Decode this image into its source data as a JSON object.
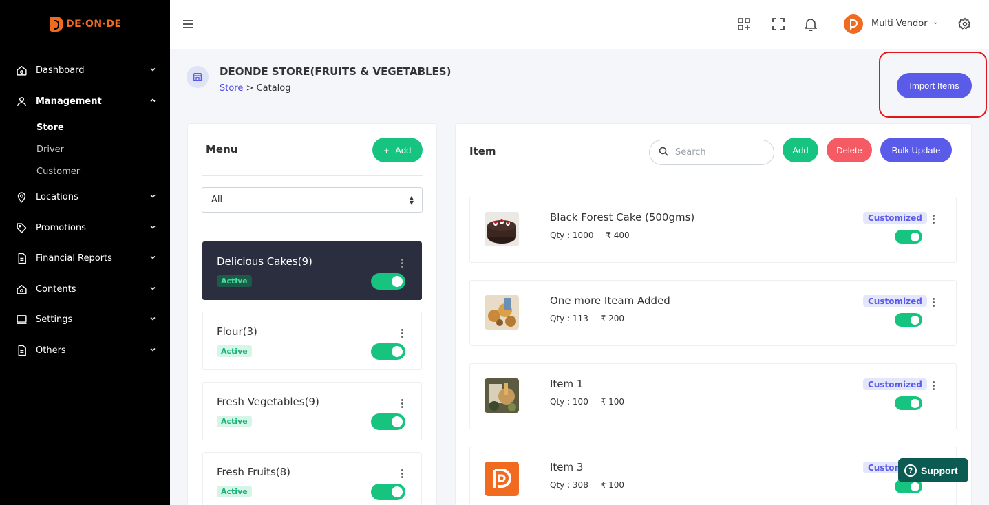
{
  "app": {
    "logo_text": "DE·ON·DE"
  },
  "sidebar": {
    "items": [
      {
        "label": "Dashboard",
        "icon": "home-icon",
        "expanded": false
      },
      {
        "label": "Management",
        "icon": "user-icon",
        "expanded": true
      },
      {
        "label": "Locations",
        "icon": "location-pin-icon",
        "expanded": false
      },
      {
        "label": "Promotions",
        "icon": "tag-icon",
        "expanded": false
      },
      {
        "label": "Financial Reports",
        "icon": "document-icon",
        "expanded": false
      },
      {
        "label": "Contents",
        "icon": "home-icon",
        "expanded": false
      },
      {
        "label": "Settings",
        "icon": "monitor-icon",
        "expanded": false
      },
      {
        "label": "Others",
        "icon": "document-icon",
        "expanded": false
      }
    ],
    "submenu": [
      {
        "label": "Store",
        "active": true
      },
      {
        "label": "Driver",
        "active": false
      },
      {
        "label": "Customer",
        "active": false
      }
    ]
  },
  "topbar": {
    "icons": [
      "menu-icon",
      "qr-add-icon",
      "fullscreen-icon",
      "bell-icon",
      "gear-icon"
    ],
    "user_name": "Multi Vendor",
    "user_chevron": "⌄"
  },
  "page": {
    "title": "DEONDE STORE(FRUITS & VEGETABLES)",
    "breadcrumb": {
      "link": "Store",
      "separator": ">",
      "current": "Catalog"
    },
    "import_button": "Import Items"
  },
  "menu_panel": {
    "title": "Menu",
    "add_button": "Add",
    "add_icon": "+",
    "filter": {
      "selected": "All"
    },
    "categories": [
      {
        "name": "Delicious Cakes(9)",
        "status": "Active",
        "selected": true,
        "enabled": true
      },
      {
        "name": "Flour(3)",
        "status": "Active",
        "selected": false,
        "enabled": true
      },
      {
        "name": "Fresh Vegetables(9)",
        "status": "Active",
        "selected": false,
        "enabled": true
      },
      {
        "name": "Fresh Fruits(8)",
        "status": "Active",
        "selected": false,
        "enabled": true
      }
    ]
  },
  "item_panel": {
    "title": "Item",
    "search_placeholder": "Search",
    "add_button": "Add",
    "delete_button": "Delete",
    "bulk_button": "Bulk Update",
    "items": [
      {
        "name": "Black Forest Cake (500gms)",
        "qty": "Qty : 1000",
        "price": "₹ 400",
        "badge": "Customized",
        "enabled": true
      },
      {
        "name": "One more Iteam Added",
        "qty": "Qty : 113",
        "price": "₹ 200",
        "badge": "Customized",
        "enabled": true
      },
      {
        "name": "Item 1",
        "qty": "Qty : 100",
        "price": "₹ 100",
        "badge": "Customized",
        "enabled": true
      },
      {
        "name": "Item 3",
        "qty": "Qty : 308",
        "price": "₹ 100",
        "badge": "Customized",
        "enabled": true
      }
    ]
  },
  "support": {
    "label": "Support",
    "icon": "?"
  },
  "colors": {
    "accent": "#5b5bea",
    "green": "#16c47f",
    "red": "#f45b64",
    "brand": "#f06a1f",
    "highlight": "#e4141b"
  }
}
